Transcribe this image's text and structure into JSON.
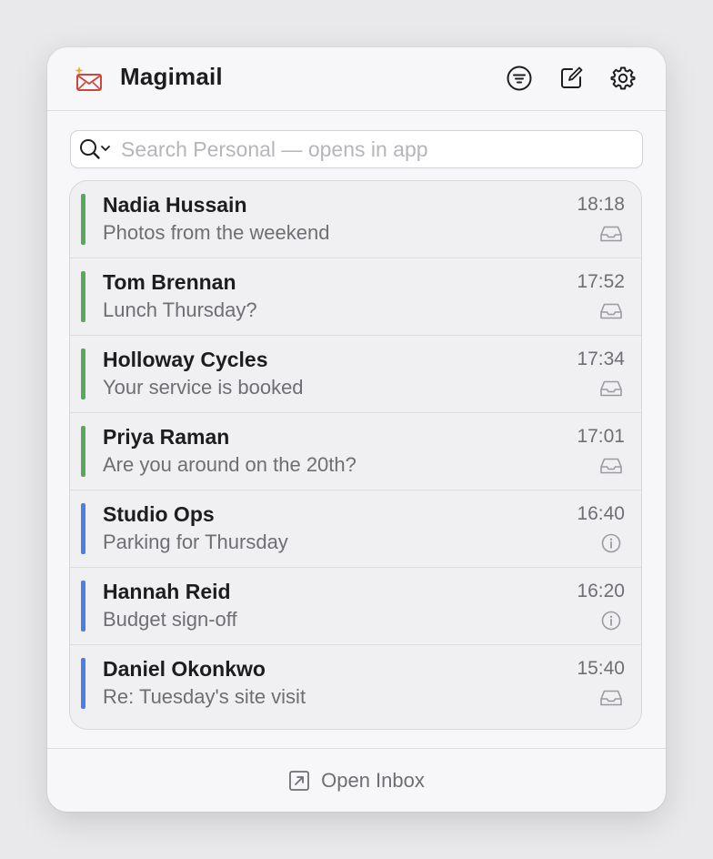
{
  "header": {
    "title": "Magimail",
    "logo_icon": "sparkle-envelope-icon",
    "actions": [
      {
        "name": "filter-button",
        "icon": "filter-circle-icon"
      },
      {
        "name": "compose-button",
        "icon": "compose-icon"
      },
      {
        "name": "settings-button",
        "icon": "gear-icon"
      }
    ]
  },
  "search": {
    "placeholder": "Search Personal — opens in app",
    "value": ""
  },
  "messages": [
    {
      "sender": "Nadia Hussain",
      "subject": "Photos from the weekend",
      "time": "18:18",
      "accent": "#5aa85e",
      "icon": "inbox-tray-icon"
    },
    {
      "sender": "Tom Brennan",
      "subject": "Lunch Thursday?",
      "time": "17:52",
      "accent": "#5aa85e",
      "icon": "inbox-tray-icon"
    },
    {
      "sender": "Holloway Cycles",
      "subject": "Your service is booked",
      "time": "17:34",
      "accent": "#5aa85e",
      "icon": "inbox-tray-icon"
    },
    {
      "sender": "Priya Raman",
      "subject": "Are you around on the 20th?",
      "time": "17:01",
      "accent": "#5aa85e",
      "icon": "inbox-tray-icon"
    },
    {
      "sender": "Studio Ops",
      "subject": "Parking for Thursday",
      "time": "16:40",
      "accent": "#4c7fe0",
      "icon": "info-circle-icon"
    },
    {
      "sender": "Hannah Reid",
      "subject": "Budget sign-off",
      "time": "16:20",
      "accent": "#4c7fe0",
      "icon": "info-circle-icon"
    },
    {
      "sender": "Daniel Okonkwo",
      "subject": "Re: Tuesday's site visit",
      "time": "15:40",
      "accent": "#4c7fe0",
      "icon": "inbox-tray-icon"
    }
  ],
  "footer": {
    "open_inbox_label": "Open Inbox",
    "icon": "open-external-icon"
  },
  "colors": {
    "personal_accent": "#5aa85e",
    "work_accent": "#4c7fe0",
    "logo": "#c9483f",
    "logo_sparkle": "#e8b030"
  }
}
